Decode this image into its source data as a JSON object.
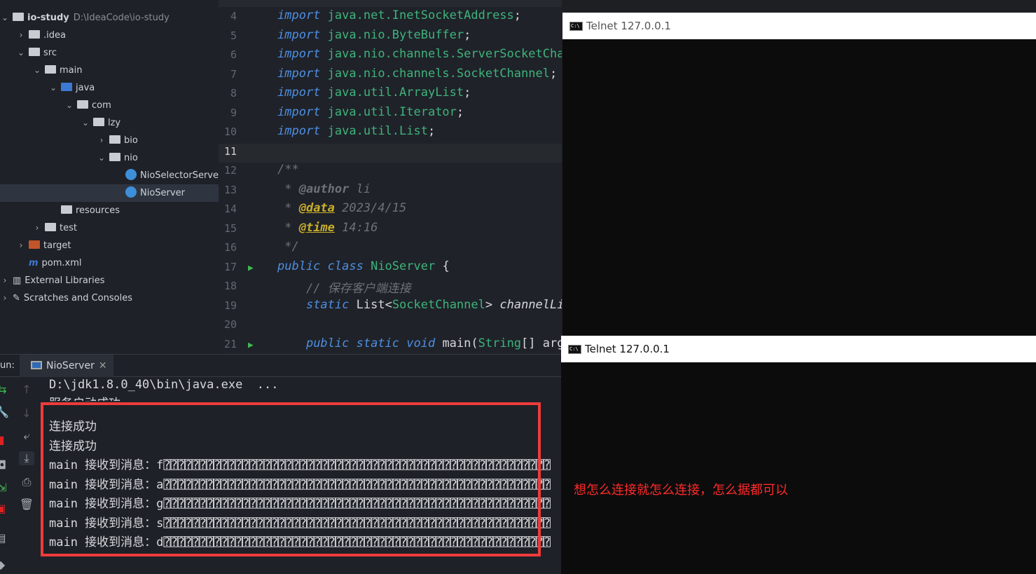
{
  "project": {
    "root": "io-study",
    "root_path": "D:\\IdeaCode\\io-study",
    "items": [
      {
        "label": ".idea",
        "depth": 1,
        "chev": "›",
        "type": "folder"
      },
      {
        "label": "src",
        "depth": 1,
        "chev": "⌄",
        "type": "folder"
      },
      {
        "label": "main",
        "depth": 2,
        "chev": "⌄",
        "type": "folder"
      },
      {
        "label": "java",
        "depth": 3,
        "chev": "⌄",
        "type": "folder-blue"
      },
      {
        "label": "com",
        "depth": 4,
        "chev": "⌄",
        "type": "package"
      },
      {
        "label": "lzy",
        "depth": 5,
        "chev": "⌄",
        "type": "package"
      },
      {
        "label": "bio",
        "depth": 6,
        "chev": "›",
        "type": "package"
      },
      {
        "label": "nio",
        "depth": 6,
        "chev": "⌄",
        "type": "package"
      },
      {
        "label": "NioSelectorServer",
        "depth": 7,
        "chev": "",
        "type": "class"
      },
      {
        "label": "NioServer",
        "depth": 7,
        "chev": "",
        "type": "class",
        "selected": true
      },
      {
        "label": "resources",
        "depth": 3,
        "chev": "",
        "type": "folder"
      },
      {
        "label": "test",
        "depth": 2,
        "chev": "›",
        "type": "folder"
      },
      {
        "label": "target",
        "depth": 1,
        "chev": "›",
        "type": "folder-orange"
      },
      {
        "label": "pom.xml",
        "depth": 1,
        "chev": "",
        "type": "maven"
      },
      {
        "label": "External Libraries",
        "depth": 0,
        "chev": "›",
        "type": "libs"
      },
      {
        "label": "Scratches and Consoles",
        "depth": 0,
        "chev": "›",
        "type": "scratch"
      }
    ]
  },
  "editor": {
    "lines": [
      {
        "n": "4",
        "html": "<span class='kw'>import</span> <span class='str'>java.net.InetSocketAddress</span><span class='pl'>;</span>"
      },
      {
        "n": "5",
        "html": "<span class='kw'>import</span> <span class='str'>java.nio.ByteBuffer</span><span class='pl'>;</span>"
      },
      {
        "n": "6",
        "html": "<span class='kw'>import</span> <span class='str'>java.nio.channels.ServerSocketChannel</span><span class='pl'>;</span>"
      },
      {
        "n": "7",
        "html": "<span class='kw'>import</span> <span class='str'>java.nio.channels.SocketChannel</span><span class='pl'>;</span>"
      },
      {
        "n": "8",
        "html": "<span class='kw'>import</span> <span class='str'>java.util.ArrayList</span><span class='pl'>;</span>"
      },
      {
        "n": "9",
        "html": "<span class='kw'>import</span> <span class='str'>java.util.Iterator</span><span class='pl'>;</span>"
      },
      {
        "n": "10",
        "html": "<span class='kw'>import</span> <span class='str'>java.util.List</span><span class='pl'>;</span>"
      },
      {
        "n": "11",
        "html": ""
      },
      {
        "n": "12",
        "html": "<span class='cm'>/**</span>"
      },
      {
        "n": "13",
        "html": "<span class='cm'> * <b>@author</b> li</span>"
      },
      {
        "n": "14",
        "html": "<span class='cm'> * </span><span class='tag'>@data</span><span class='cm'> 2023/4/15</span>"
      },
      {
        "n": "15",
        "html": "<span class='cm'> * </span><span class='tag'>@time</span><span class='cm'> 14:16</span>"
      },
      {
        "n": "16",
        "html": "<span class='cm'> */</span>"
      },
      {
        "n": "17",
        "html": "<span class='kw'>public class</span> <span class='tp'>NioServer</span> <span class='pl'>{</span>"
      },
      {
        "n": "18",
        "html": "    <span class='cm'>// 保存客户端连接</span>"
      },
      {
        "n": "19",
        "html": "    <span class='kw'>static</span> <span class='pl'>List&lt;</span><span class='tp'>SocketChannel</span><span class='pl'>&gt;</span> <span class='pl' style='font-style:italic'>channelList</span>"
      },
      {
        "n": "20",
        "html": ""
      },
      {
        "n": "21",
        "html": "    <span class='kw'>public static void</span> <span class='pl'>main(</span><span class='tp'>String</span><span class='pl'>[] args)</span>"
      }
    ]
  },
  "run": {
    "label": "un:",
    "tab": "NioServer",
    "lines": [
      "D:\\jdk1.8.0_40\\bin\\java.exe  ...",
      "服务启动成功",
      "连接成功",
      "连接成功",
      "main 接收到消息：f⍰⍰⍰⍰⍰⍰⍰⍰⍰⍰⍰⍰⍰⍰⍰⍰⍰⍰⍰⍰⍰⍰⍰⍰⍰⍰⍰⍰⍰⍰⍰⍰⍰⍰⍰⍰⍰⍰⍰⍰⍰⍰⍰⍰⍰⍰⍰⍰⍰⍰⍰⍰⍰⍰",
      "main 接收到消息：a⍰⍰⍰⍰⍰⍰⍰⍰⍰⍰⍰⍰⍰⍰⍰⍰⍰⍰⍰⍰⍰⍰⍰⍰⍰⍰⍰⍰⍰⍰⍰⍰⍰⍰⍰⍰⍰⍰⍰⍰⍰⍰⍰⍰⍰⍰⍰⍰⍰⍰⍰⍰⍰⍰",
      "main 接收到消息：g⍰⍰⍰⍰⍰⍰⍰⍰⍰⍰⍰⍰⍰⍰⍰⍰⍰⍰⍰⍰⍰⍰⍰⍰⍰⍰⍰⍰⍰⍰⍰⍰⍰⍰⍰⍰⍰⍰⍰⍰⍰⍰⍰⍰⍰⍰⍰⍰⍰⍰⍰⍰⍰⍰",
      "main 接收到消息：s⍰⍰⍰⍰⍰⍰⍰⍰⍰⍰⍰⍰⍰⍰⍰⍰⍰⍰⍰⍰⍰⍰⍰⍰⍰⍰⍰⍰⍰⍰⍰⍰⍰⍰⍰⍰⍰⍰⍰⍰⍰⍰⍰⍰⍰⍰⍰⍰⍰⍰⍰⍰⍰⍰",
      "main 接收到消息：d⍰⍰⍰⍰⍰⍰⍰⍰⍰⍰⍰⍰⍰⍰⍰⍰⍰⍰⍰⍰⍰⍰⍰⍰⍰⍰⍰⍰⍰⍰⍰⍰⍰⍰⍰⍰⍰⍰⍰⍰⍰⍰⍰⍰⍰⍰⍰⍰⍰⍰⍰⍰⍰⍰"
    ]
  },
  "telnet1": {
    "title": "Telnet 127.0.0.1"
  },
  "telnet2": {
    "title": "Telnet 127.0.0.1"
  },
  "annotation": {
    "text": "想怎么连接就怎么连接，怎么据都可以",
    "color": "#ff2a2a"
  },
  "colors": {
    "highlight_box": "#ef3b3b"
  }
}
